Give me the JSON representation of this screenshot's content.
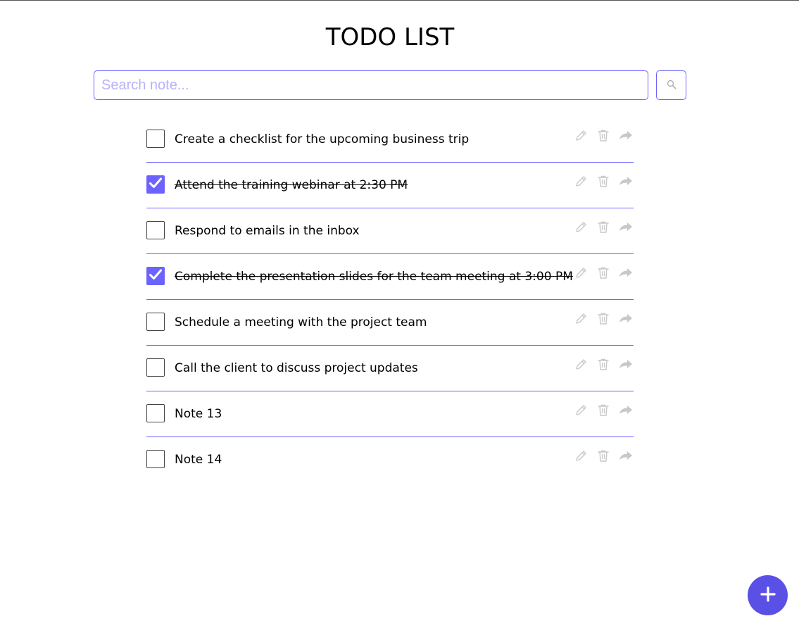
{
  "header": {
    "title": "TODO LIST"
  },
  "search": {
    "placeholder": "Search note...",
    "value": "",
    "button_icon": "search-icon"
  },
  "todos": [
    {
      "text": "Create a checklist for the upcoming business trip",
      "done": false
    },
    {
      "text": "Attend the training webinar at 2:30 PM",
      "done": true
    },
    {
      "text": "Respond to emails in the inbox",
      "done": false
    },
    {
      "text": "Complete the presentation slides for the team meeting at 3:00 PM",
      "done": true
    },
    {
      "text": "Schedule a meeting with the project team",
      "done": false
    },
    {
      "text": "Call the client to discuss project updates",
      "done": false
    },
    {
      "text": "Note 13",
      "done": false
    },
    {
      "text": "Note 14",
      "done": false
    }
  ],
  "item_actions": [
    "edit-icon",
    "trash-icon",
    "share-icon"
  ],
  "fab": {
    "icon": "plus-icon"
  },
  "colors": {
    "accent": "#6c63ff",
    "fab": "#5b50e6",
    "placeholder": "#b7b1fb",
    "action_icon": "#c8c8c8"
  }
}
